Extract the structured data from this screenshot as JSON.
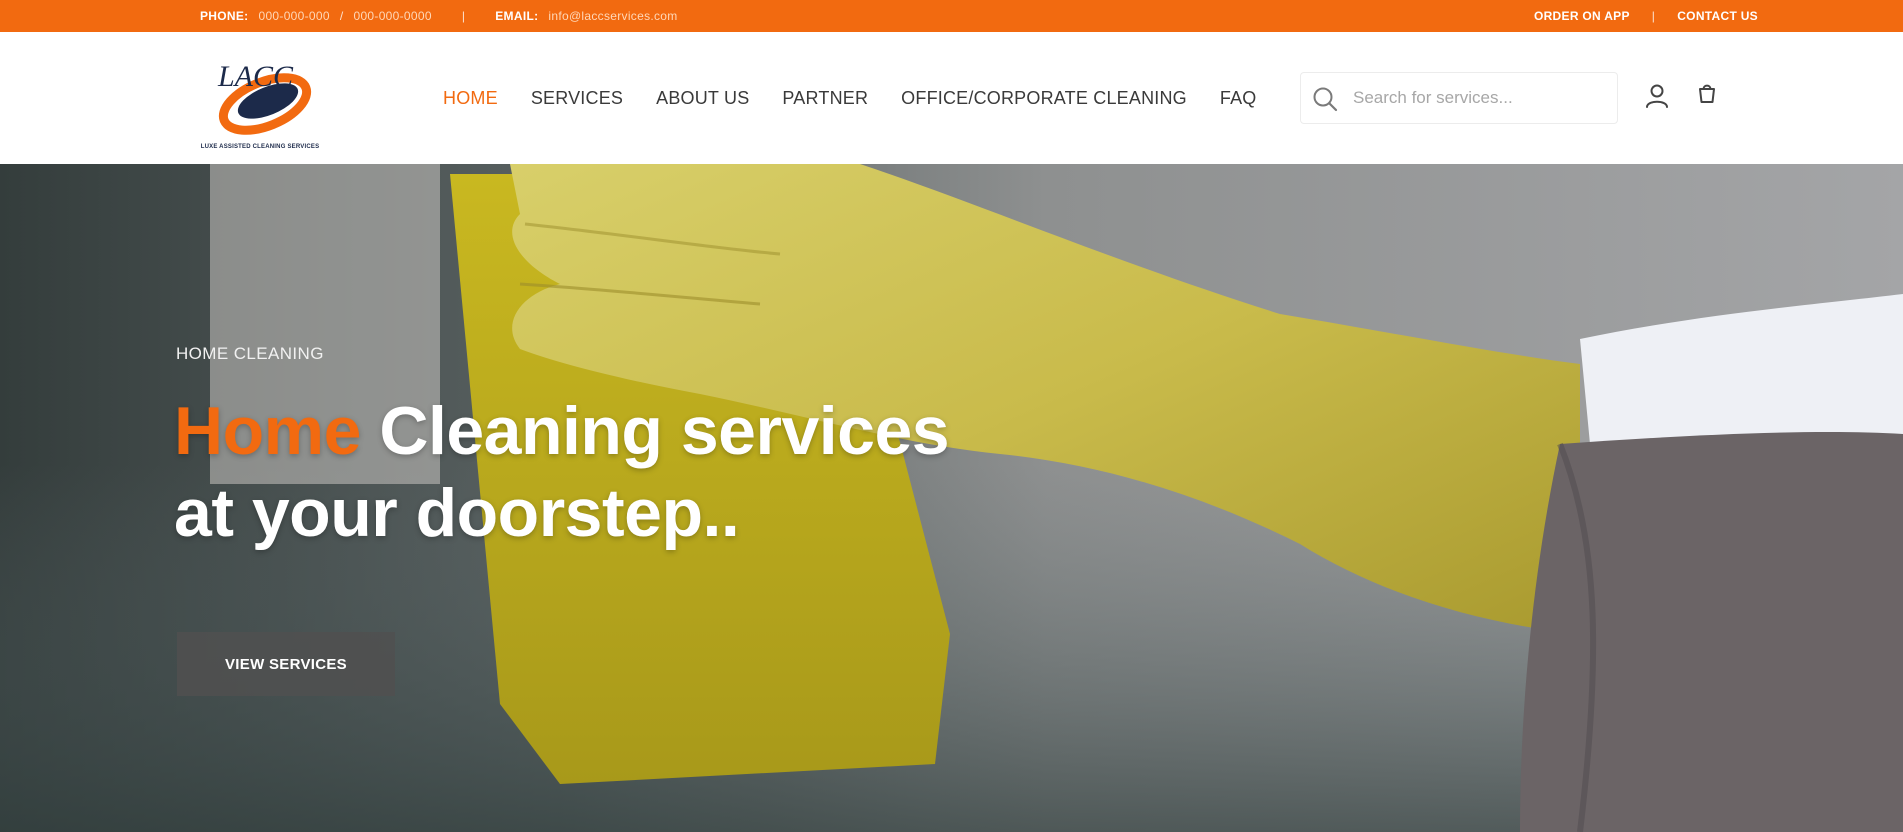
{
  "topbar": {
    "phone_label": "PHONE:",
    "phone_1": "000-000-000",
    "phone_2": "000-000-0000",
    "email_label": "EMAIL:",
    "email_value": "info@laccservices.com",
    "order_link": "ORDER ON APP",
    "contact_link": "CONTACT US"
  },
  "logo": {
    "letters": "LACC",
    "tagline": "LUXE ASSISTED CLEANING SERVICES"
  },
  "nav": {
    "items": [
      {
        "label": "HOME"
      },
      {
        "label": "SERVICES"
      },
      {
        "label": "ABOUT US"
      },
      {
        "label": "PARTNER"
      },
      {
        "label": "OFFICE/CORPORATE CLEANING"
      },
      {
        "label": "FAQ"
      }
    ]
  },
  "search": {
    "placeholder": "Search for services..."
  },
  "hero": {
    "kicker": "HOME CLEANING",
    "title_accent": "Home",
    "title_line1_rest": " Cleaning services",
    "title_line2": "at your doorstep..",
    "button_label": "VIEW SERVICES"
  },
  "colors": {
    "brand_orange": "#f26a10",
    "nav_text": "#3a3a3a",
    "logo_navy": "#1c2a4a"
  },
  "icons": [
    "search-icon",
    "user-icon",
    "cart-icon"
  ]
}
